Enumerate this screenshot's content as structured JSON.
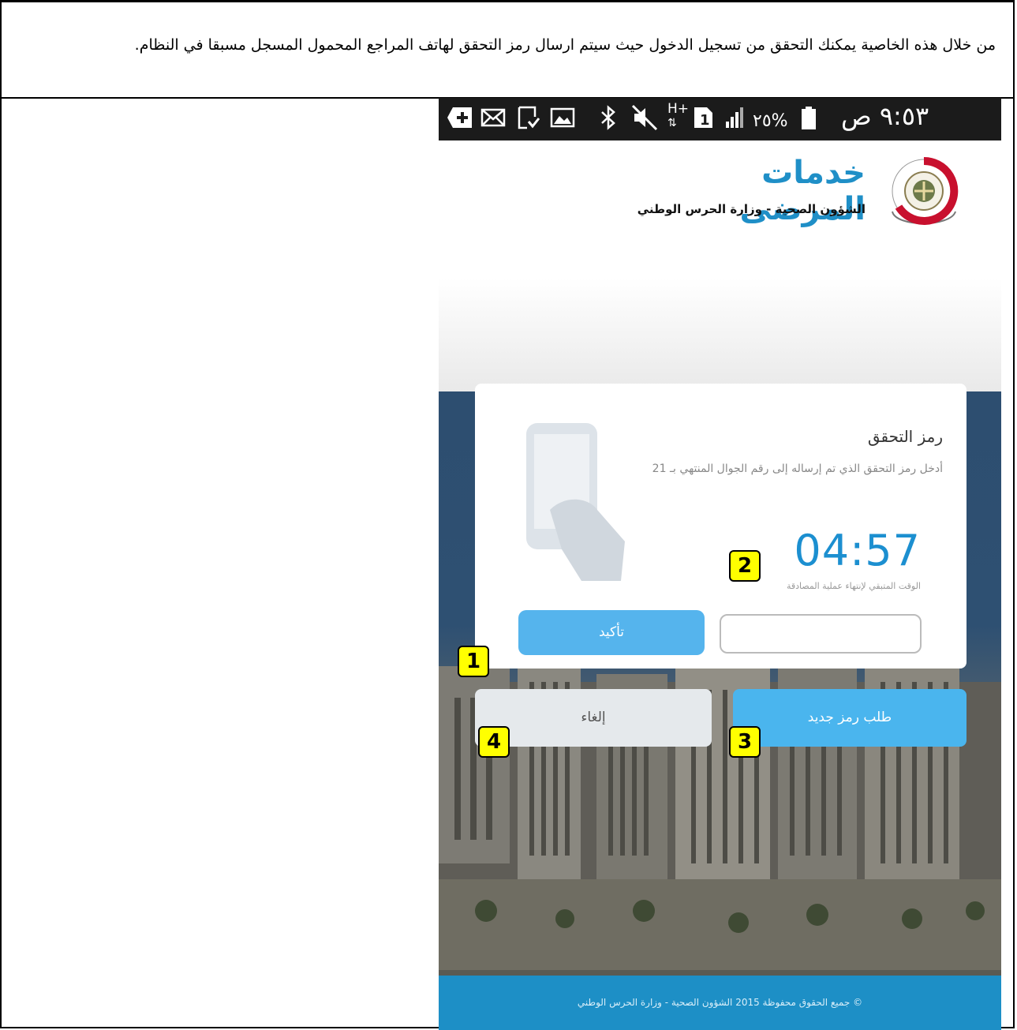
{
  "document": {
    "caption": "من خلال هذه الخاصية يمكنك التحقق من تسجيل الدخول حيث  سيتم ارسال رمز التحقق لهاتف المراجع المحمول  المسجل مسبقا في النظام."
  },
  "statusbar": {
    "time": "٩:٥٣ ص",
    "battery": "٢٥%",
    "network": "H+",
    "sim": "1",
    "icons": [
      "plus-icon",
      "mail-icon",
      "download-icon",
      "image-icon",
      "bluetooth-icon",
      "mute-icon",
      "network-icon",
      "sim-icon",
      "signal-icon",
      "battery-icon"
    ]
  },
  "header": {
    "title": "خدمات المرضى",
    "subtitle": "الشؤون الصحية - وزارة الحرس الوطني"
  },
  "card": {
    "title": "رمز التحقق",
    "description": "أدخل رمز التحقق الذي تم إرساله إلى رقم الجوال المنتهي بـ 21",
    "timer": "04:57",
    "timer_label": "الوقت المتبقي لإنتهاء عملية المصادقة",
    "code_value": "",
    "confirm_label": "تأكيد"
  },
  "actions": {
    "cancel_label": "إلغاء",
    "new_code_label": "طلب رمز جديد"
  },
  "footer": {
    "text": "© جميع الحقوق محفوظة 2015 الشؤون الصحية - وزارة الحرس الوطني"
  },
  "badges": {
    "b1": "1",
    "b2": "2",
    "b3": "3",
    "b4": "4"
  },
  "colors": {
    "accent": "#1c8fd0",
    "button_blue": "#55b4ed",
    "badge": "#ffff00",
    "footer": "#1d8fc6"
  }
}
